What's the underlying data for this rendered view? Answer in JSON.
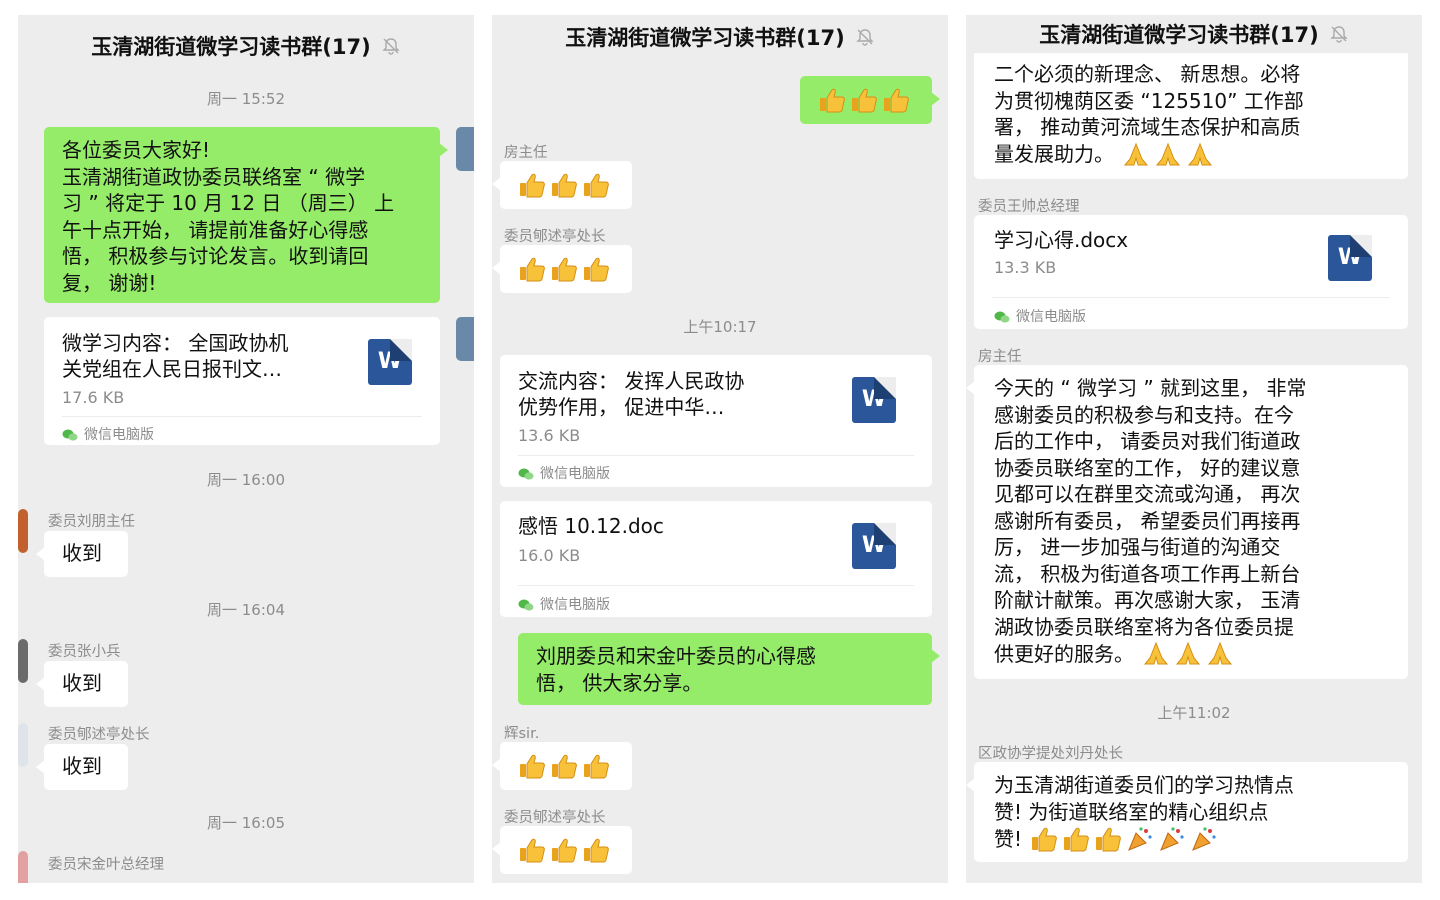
{
  "chat_title": "玉清湖街道微学习读书群(17)",
  "file_source": "微信电脑版",
  "file_badge": "W",
  "colors": {
    "self_bubble": "#95ec69",
    "peer_bubble": "#ffffff",
    "background": "#ededed",
    "word_icon": "#2b579a"
  },
  "panel1": {
    "time1": "周一 15:52",
    "msg1_lines": [
      "各位委员大家好!",
      "玉清湖街道政协委员联络室 “ 微学",
      "习 ” 将定于 10 月 12 日 （周三） 上",
      "午十点开始， 请提前准备好心得感",
      "悟， 积极参与讨论发言。收到请回",
      "复， 谢谢!"
    ],
    "file1_name_lines": [
      "微学习内容： 全国政协机",
      "关党组在人民日报刊文…"
    ],
    "file1_size": "17.6 KB",
    "time2": "周一 16:00",
    "sender1": "委员刘朋主任",
    "reply1": "收到",
    "time3": "周一 16:04",
    "sender2": "委员张小兵",
    "reply2": "收到",
    "sender3": "委员郇述亭处长",
    "reply3": "收到",
    "time4": "周一 16:05",
    "sender4": "委员宋金叶总经理"
  },
  "panel2": {
    "sender1": "房主任",
    "sender2": "委员郇述亭处长",
    "time1": "上午10:17",
    "file1_name_lines": [
      "交流内容： 发挥人民政协",
      "优势作用， 促进中华…"
    ],
    "file1_size": "13.6 KB",
    "file2_name": "感悟 10.12.doc",
    "file2_size": "16.0 KB",
    "msg1_lines": [
      "刘朋委员和宋金叶委员的心得感",
      "悟， 供大家分享。"
    ],
    "sender3": "辉sir.",
    "sender4": "委员郇述亭处长"
  },
  "panel3": {
    "msg1_lines": [
      "二个必须的新理念、 新思想。必将",
      "为贯彻槐荫区委 “125510” 工作部",
      "署， 推动黄河流域生态保护和高质",
      "量发展助力。"
    ],
    "sender1": "委员王帅总经理",
    "file1_name": "学习心得.docx",
    "file1_size": "13.3 KB",
    "sender2": "房主任",
    "msg2_lines": [
      "今天的 “ 微学习 ” 就到这里， 非常",
      "感谢委员的积极参与和支持。在今",
      "后的工作中， 请委员对我们街道政",
      "协委员联络室的工作， 好的建议意",
      "见都可以在群里交流或沟通， 再次",
      "感谢所有委员， 希望委员们再接再",
      "厉， 进一步加强与街道的沟通交",
      "流， 积极为街道各项工作再上新台",
      "阶献计献策。再次感谢大家， 玉清",
      "湖政协委员联络室将为各位委员提",
      "供更好的服务。"
    ],
    "time1": "上午11:02",
    "sender3": "区政协学提处刘丹处长",
    "msg3_lines": [
      "为玉清湖街道委员们的学习热情点",
      "赞! 为街道联络室的精心组织点",
      "赞!"
    ]
  }
}
